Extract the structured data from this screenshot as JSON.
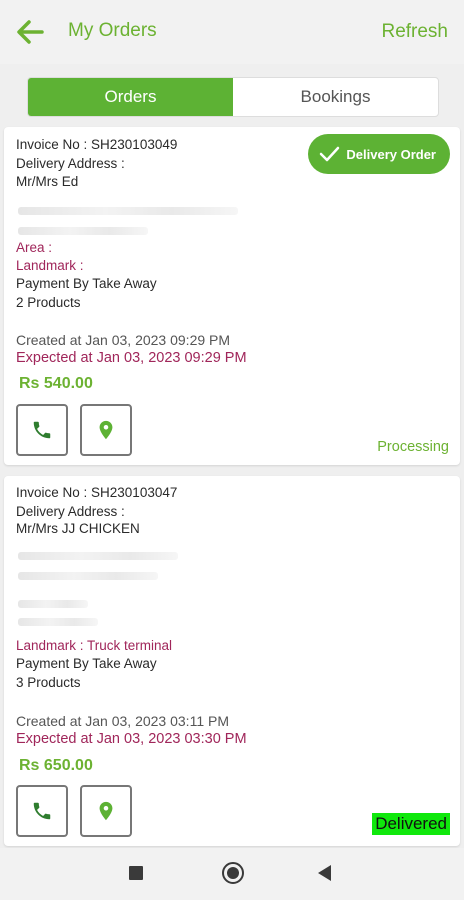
{
  "header": {
    "title": "My Orders",
    "refresh_label": "Refresh",
    "back_icon": "arrow-left-icon"
  },
  "tabs": [
    {
      "label": "Orders",
      "active": true
    },
    {
      "label": "Bookings",
      "active": false
    }
  ],
  "orders": [
    {
      "invoice": "Invoice No  :  SH230103049",
      "delivery_address_label": "Delivery Address :",
      "name": "Mr/Mrs Ed",
      "area": "Area :",
      "landmark": "Landmark :",
      "payment": "Payment By Take Away",
      "products": "2 Products",
      "created": "Created at Jan 03, 2023 09:29 PM",
      "expected": "Expected at Jan 03, 2023 09:29 PM",
      "price": "Rs 540.00",
      "badge": "Delivery Order",
      "status": "Processing"
    },
    {
      "invoice": "Invoice No  :  SH230103047",
      "delivery_address_label": "Delivery Address :",
      "name": "Mr/Mrs JJ CHICKEN",
      "landmark": "Landmark : Truck terminal",
      "payment": "Payment By Take Away",
      "products": "3 Products",
      "created": "Created at Jan 03, 2023 03:11 PM",
      "expected": "Expected at Jan 03, 2023 03:30 PM",
      "price": "Rs 650.00",
      "status": "Delivered"
    }
  ],
  "colors": {
    "brand_green": "#5db234",
    "accent_maroon": "#a0265a",
    "delivered_green": "#10e80c"
  }
}
